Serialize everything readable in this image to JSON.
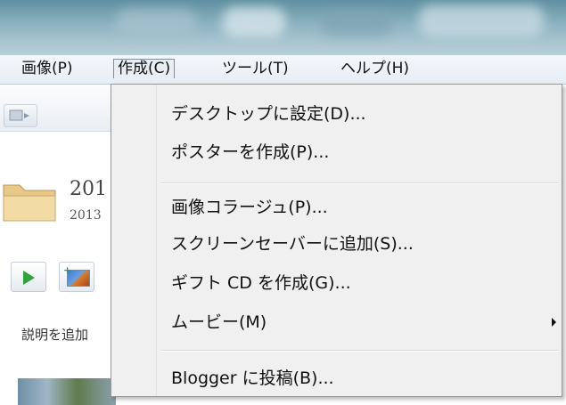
{
  "menubar": {
    "items": [
      {
        "label": "画像(P)"
      },
      {
        "label": "作成(C)"
      },
      {
        "label": "ツール(T)"
      },
      {
        "label": "ヘルプ(H)"
      }
    ]
  },
  "left_pane": {
    "folder_title": "201",
    "folder_date": "2013",
    "description": "説明を追加"
  },
  "dropdown": {
    "items": [
      {
        "label": "デスクトップに設定(D)..."
      },
      {
        "label": "ポスターを作成(P)..."
      },
      {
        "label": "画像コラージュ(P)..."
      },
      {
        "label": "スクリーンセーバーに追加(S)..."
      },
      {
        "label": "ギフト CD を作成(G)..."
      },
      {
        "label": "ムービー(M)"
      },
      {
        "label": "Blogger に投稿(B)..."
      }
    ]
  },
  "colors": {
    "menu_highlight_border": "#7f8fa3",
    "play_green": "#2fa33a",
    "dropdown_bg": "#f0f0f0"
  }
}
